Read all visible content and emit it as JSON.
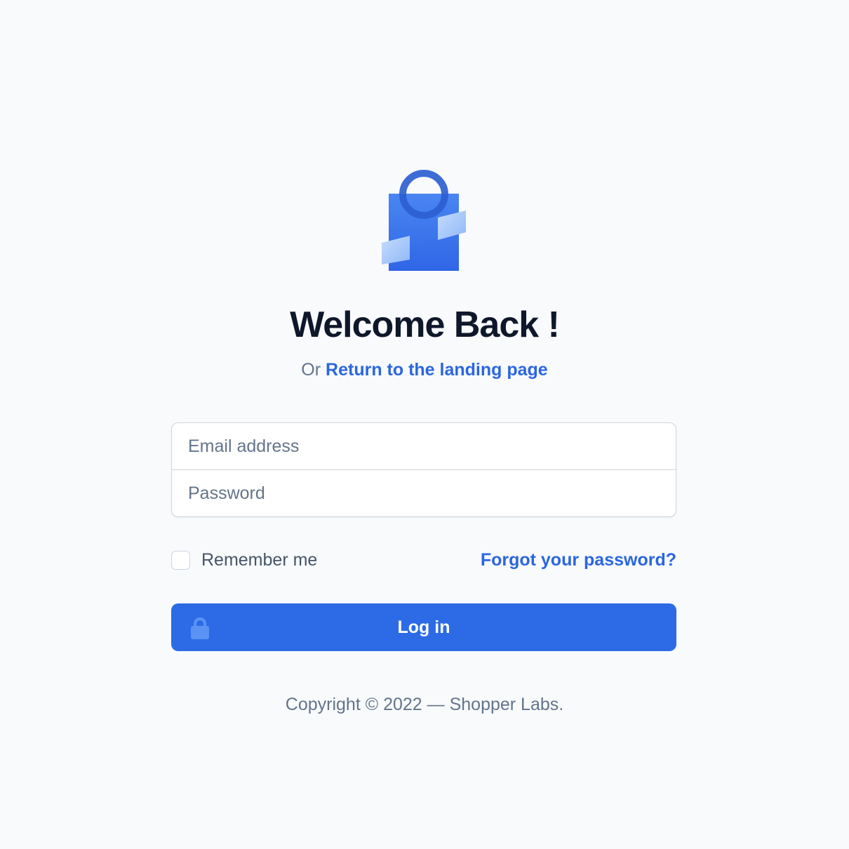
{
  "logo": {
    "icon": "shopping-bag-icon",
    "colors": {
      "bag": "#3b76ee",
      "handle": "#2d5fd1",
      "ribbon": "#a9c9fb"
    }
  },
  "heading": {
    "title": "Welcome Back !",
    "subtitle_prefix": "Or",
    "landing_link": "Return to the landing page"
  },
  "form": {
    "email_placeholder": "Email address",
    "email_value": "",
    "password_placeholder": "Password",
    "password_value": "",
    "remember_label": "Remember me",
    "remember_checked": false,
    "forgot_link": "Forgot your password?",
    "login_label": "Log in",
    "login_icon": "lock-icon"
  },
  "footer": {
    "copyright": "Copyright © 2022 — Shopper Labs."
  },
  "theme": {
    "background": "#f8fafc",
    "accent": "#2c6be5",
    "link": "#2c66e0",
    "heading": "#0f172a",
    "muted": "#64748b"
  }
}
